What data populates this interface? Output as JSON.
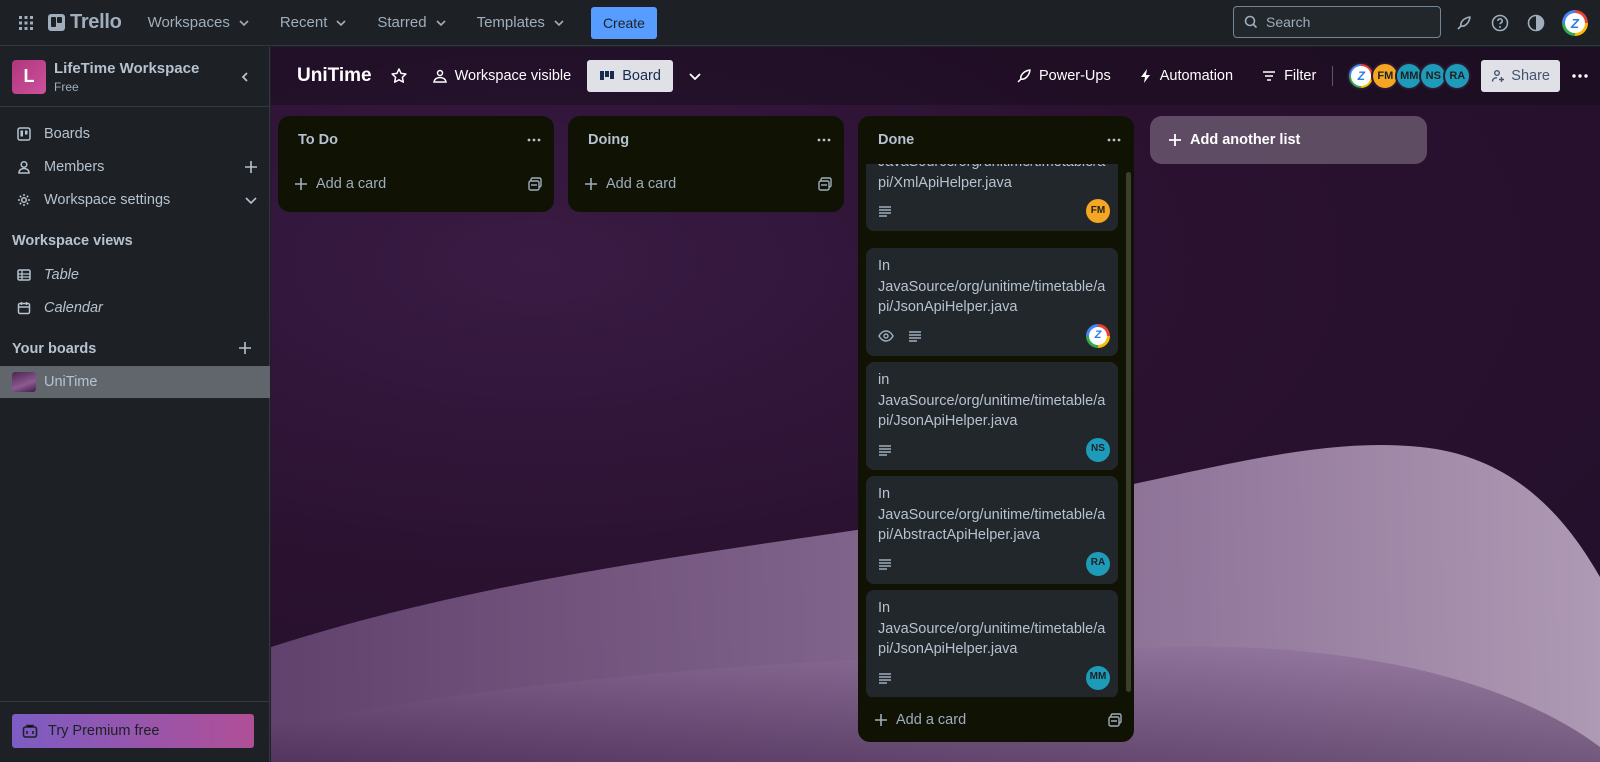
{
  "topnav": {
    "logo": "Trello",
    "menus": [
      "Workspaces",
      "Recent",
      "Starred",
      "Templates"
    ],
    "create_label": "Create",
    "search_placeholder": "Search"
  },
  "sidebar": {
    "workspace_initial": "L",
    "workspace_name": "LifeTime Workspace",
    "workspace_plan": "Free",
    "items": [
      {
        "label": "Boards",
        "icon": "boards-icon"
      },
      {
        "label": "Members",
        "icon": "members-icon"
      },
      {
        "label": "Workspace settings",
        "icon": "settings-icon"
      }
    ],
    "views_heading": "Workspace views",
    "views": [
      {
        "label": "Table",
        "icon": "table-icon"
      },
      {
        "label": "Calendar",
        "icon": "calendar-icon"
      }
    ],
    "boards_heading": "Your boards",
    "boards": [
      {
        "label": "UniTime"
      }
    ],
    "premium_label": "Try Premium free"
  },
  "board": {
    "title": "UniTime",
    "visibility": "Workspace visible",
    "view_label": "Board",
    "powerups_label": "Power-Ups",
    "automation_label": "Automation",
    "filter_label": "Filter",
    "share_label": "Share",
    "members": [
      {
        "initials": "Z",
        "color": "#ffffff"
      },
      {
        "initials": "FM",
        "color": "#f5a623"
      },
      {
        "initials": "MM",
        "color": "#1e9bb8"
      },
      {
        "initials": "NS",
        "color": "#1e9bb8"
      },
      {
        "initials": "RA",
        "color": "#1e9bb8"
      }
    ]
  },
  "lists": [
    {
      "title": "To Do",
      "add_card": "Add a card",
      "cards": []
    },
    {
      "title": "Doing",
      "add_card": "Add a card",
      "cards": []
    },
    {
      "title": "Done",
      "add_card": "Add a card",
      "cards": [
        {
          "title": "JavaSource/org/unitime/timetable/api/XmlApiHelper.java",
          "lines": [
            "JavaSource/org/unitime/timetable/a",
            "pi/XmlApiHelper.java"
          ],
          "watch": false,
          "member": "FM",
          "member_color": "#f5a623"
        },
        {
          "title": "In JavaSource/org/unitime/timetable/api/JsonApiHelper.java",
          "lines": [
            "In",
            "JavaSource/org/unitime/timetable/a",
            "pi/JsonApiHelper.java"
          ],
          "watch": true,
          "member": "Z",
          "member_color": "#ffffff"
        },
        {
          "title": "in JavaSource/org/unitime/timetable/api/JsonApiHelper.java",
          "lines": [
            "in",
            "JavaSource/org/unitime/timetable/a",
            "pi/JsonApiHelper.java"
          ],
          "watch": false,
          "member": "NS",
          "member_color": "#1e9bb8"
        },
        {
          "title": "In JavaSource/org/unitime/timetable/api/AbstractApiHelper.java",
          "lines": [
            "In",
            "JavaSource/org/unitime/timetable/a",
            "pi/AbstractApiHelper.java"
          ],
          "watch": false,
          "member": "RA",
          "member_color": "#1e9bb8"
        },
        {
          "title": "In JavaSource/org/unitime/timetable/api/JsonApiHelper.java",
          "lines": [
            "In",
            "JavaSource/org/unitime/timetable/a",
            "pi/JsonApiHelper.java"
          ],
          "watch": false,
          "member": "MM",
          "member_color": "#1e9bb8"
        }
      ]
    }
  ],
  "add_list_label": "Add another list"
}
